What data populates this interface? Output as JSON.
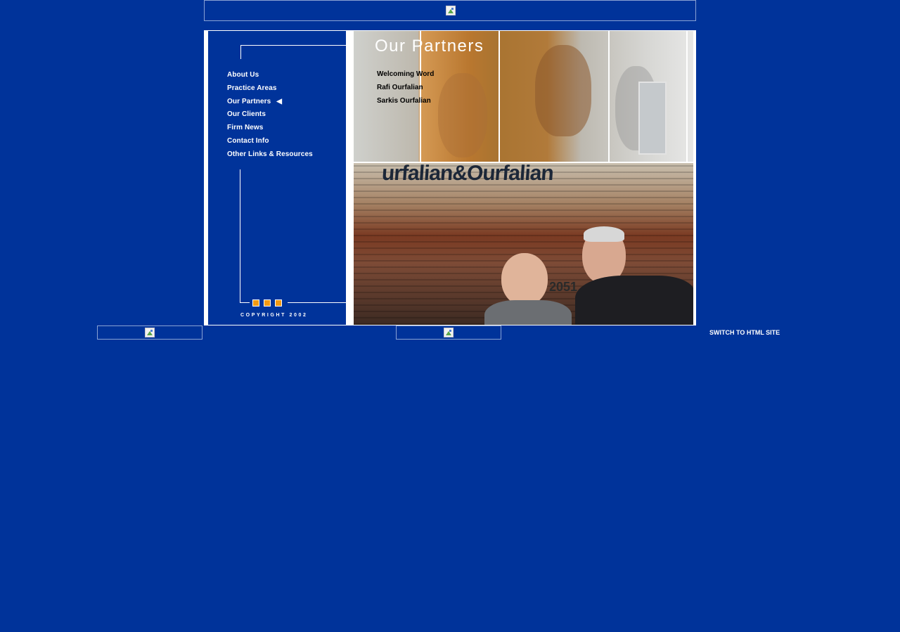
{
  "colors": {
    "background": "#00339a",
    "accent_squares": "#f39a13",
    "text": "#ffffff"
  },
  "nav": {
    "items": [
      {
        "label": "About Us"
      },
      {
        "label": "Practice Areas"
      },
      {
        "label": "Our Partners"
      },
      {
        "label": "Our Clients"
      },
      {
        "label": "Firm News"
      },
      {
        "label": "Contact Info"
      },
      {
        "label": "Other Links & Resources"
      }
    ],
    "active_marker": "◀",
    "copyright": "COPYRIGHT 2002"
  },
  "content": {
    "title": "Our Partners",
    "sub_items": [
      {
        "label": "Welcoming Word"
      },
      {
        "label": "Rafi Ourfalian"
      },
      {
        "label": "Sarkis Ourfalian"
      }
    ],
    "building_sign": "urfalian&Ourfalian",
    "building_number": "2051"
  },
  "footer": {
    "switch_label": "SWITCH TO HTML SITE"
  }
}
